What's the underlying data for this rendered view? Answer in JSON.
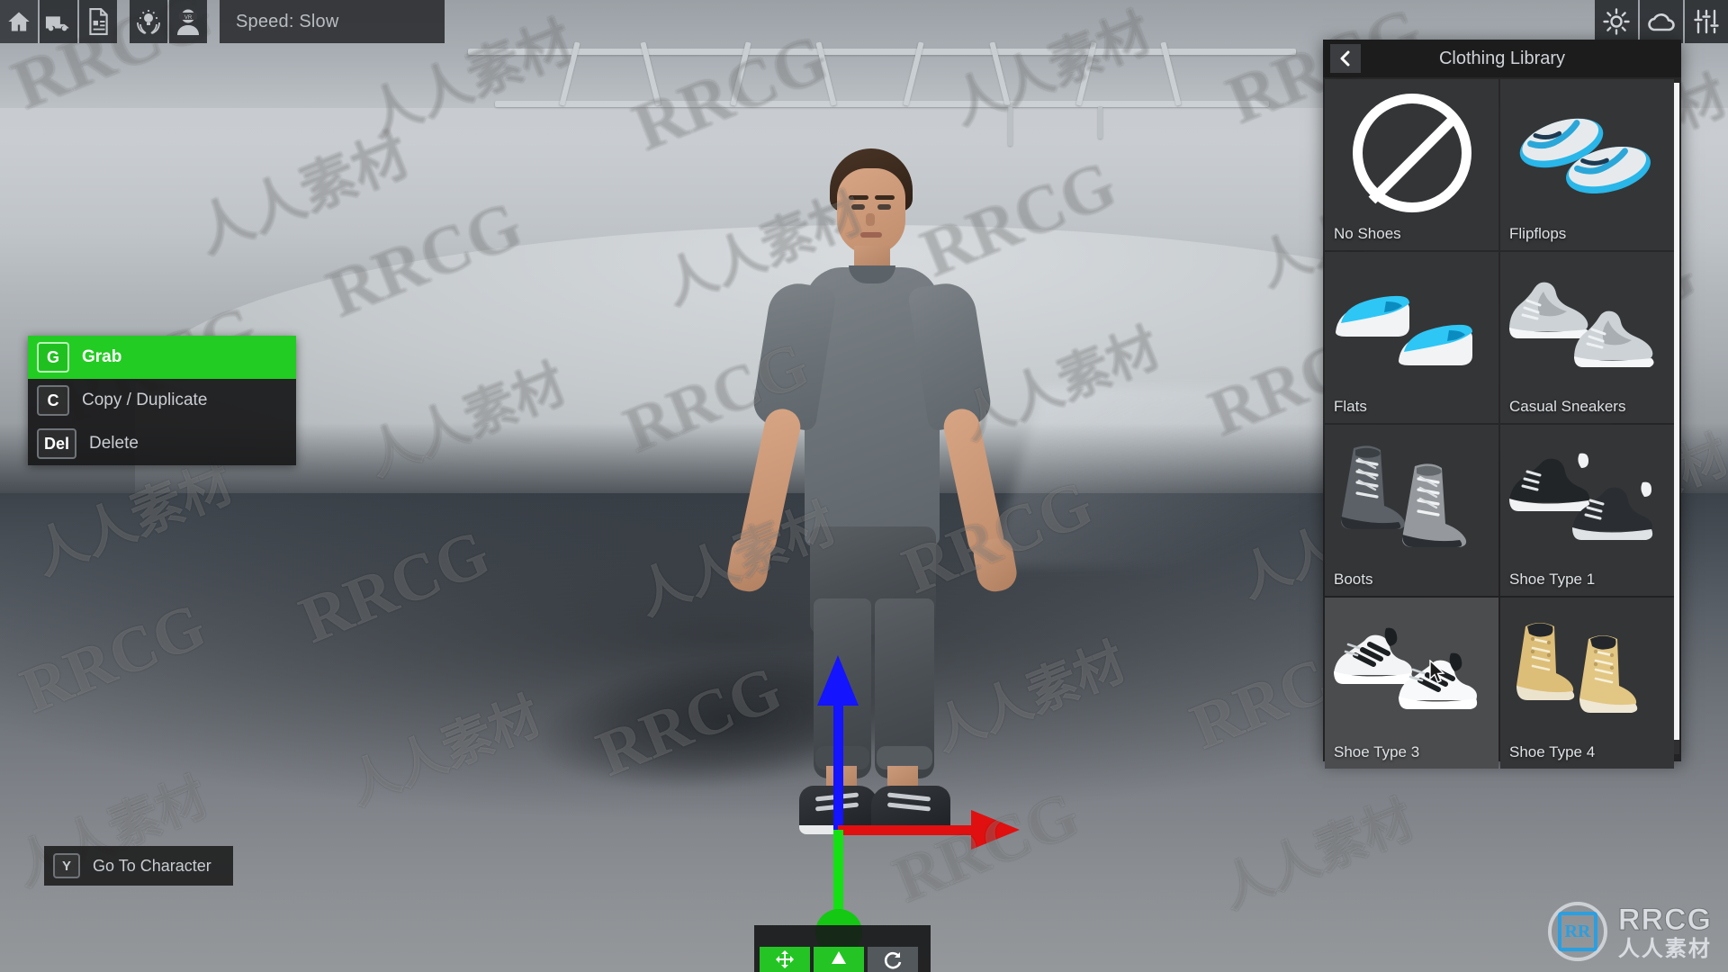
{
  "toolbar": {
    "buttons": [
      {
        "name": "home-icon",
        "label": "Home"
      },
      {
        "name": "vehicle-icon",
        "label": "Vehicle"
      },
      {
        "name": "document-icon",
        "label": "Document"
      },
      {
        "name": "idea-hands-icon",
        "label": "Tips"
      },
      {
        "name": "vr-user-icon",
        "label": "VR Mode"
      }
    ],
    "speed_label": "Speed: Slow"
  },
  "toolbar_right": {
    "buttons": [
      {
        "name": "sun-icon",
        "label": "Lighting"
      },
      {
        "name": "cloud-icon",
        "label": "Weather"
      },
      {
        "name": "sliders-icon",
        "label": "Settings"
      }
    ]
  },
  "context_menu": {
    "items": [
      {
        "key": "G",
        "label": "Grab",
        "active": true
      },
      {
        "key": "C",
        "label": "Copy / Duplicate",
        "active": false
      },
      {
        "key": "Del",
        "label": "Delete",
        "active": false
      }
    ]
  },
  "goto_character": {
    "key": "Y",
    "label": "Go To Character"
  },
  "library": {
    "title": "Clothing Library",
    "back_icon": "‹",
    "items": [
      {
        "label": "No Shoes",
        "thumb": "no-shoes",
        "hovered": false
      },
      {
        "label": "Flipflops",
        "thumb": "flipflops",
        "hovered": false
      },
      {
        "label": "Flats",
        "thumb": "flats",
        "hovered": false
      },
      {
        "label": "Casual Sneakers",
        "thumb": "casual-sneakers",
        "hovered": false
      },
      {
        "label": "Boots",
        "thumb": "boots",
        "hovered": false
      },
      {
        "label": "Shoe Type 1",
        "thumb": "shoe-type-1",
        "hovered": false
      },
      {
        "label": "Shoe Type 3",
        "thumb": "shoe-type-3",
        "hovered": true
      },
      {
        "label": "Shoe Type 4",
        "thumb": "shoe-type-4",
        "hovered": false
      }
    ]
  },
  "bottom_toolbar": {
    "buttons": [
      {
        "name": "move-tool-button",
        "label": "Move"
      },
      {
        "name": "rotate-tool-button",
        "label": "Rotate"
      },
      {
        "name": "scale-tool-button",
        "label": "Scale"
      }
    ]
  },
  "gizmo": {
    "axes": [
      {
        "name": "z-axis-up",
        "color": "#1414ff"
      },
      {
        "name": "x-axis-right",
        "color": "#e01010"
      },
      {
        "name": "y-axis-forward",
        "color": "#14e014"
      }
    ]
  },
  "watermark": {
    "latin": "RRCG",
    "chinese": "人人素材"
  },
  "branding": {
    "mark": "RR",
    "name_en": "RRCG",
    "name_cn": "人人素材"
  },
  "colors": {
    "accent_green": "#22cc22",
    "panel_bg": "#1e1e1f",
    "cell_bg": "#343537",
    "axis_x": "#e01010",
    "axis_y": "#14e014",
    "axis_z": "#1414ff"
  }
}
